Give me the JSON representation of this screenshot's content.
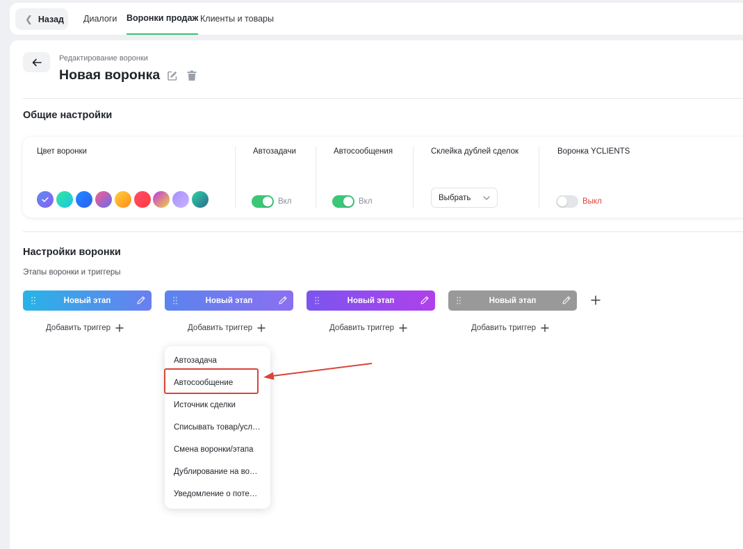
{
  "topnav": {
    "back_label": "Назад",
    "tabs": [
      {
        "label": "Диалоги",
        "active": false
      },
      {
        "label": "Воронки продаж",
        "active": true
      },
      {
        "label": "Клиенты и товары",
        "active": false
      }
    ]
  },
  "header": {
    "subtitle": "Редактирование воронки",
    "title": "Новая воронка",
    "icons": [
      "arrow-left-icon",
      "edit-icon",
      "trash-icon"
    ]
  },
  "general": {
    "title": "Общие настройки",
    "color_label": "Цвет воронки",
    "colors": [
      {
        "from": "#5a8dee",
        "to": "#8b5cf6",
        "selected": true
      },
      {
        "from": "#32e7a0",
        "to": "#19c6e6",
        "selected": false
      },
      {
        "from": "#1e8bff",
        "to": "#2f5cf5",
        "selected": false
      },
      {
        "from": "#ff5b8a",
        "to": "#5f6df2",
        "selected": false
      },
      {
        "from": "#ffd23a",
        "to": "#ff8a1c",
        "selected": false
      },
      {
        "from": "#ff4d6d",
        "to": "#ff3b3b",
        "selected": false
      },
      {
        "from": "#c036e8",
        "to": "#f0d23c",
        "selected": false
      },
      {
        "from": "#a88dff",
        "to": "#c9b5ff",
        "selected": false
      },
      {
        "from": "#2fd3a2",
        "to": "#2c6b8e",
        "selected": false
      }
    ],
    "autotasks": {
      "label": "Автозадачи",
      "state": "Вкл",
      "on": true
    },
    "automessages": {
      "label": "Автосообщения",
      "state": "Вкл",
      "on": true
    },
    "merge": {
      "label": "Склейка дублей сделок",
      "select_value": "Выбрать"
    },
    "yclients": {
      "label": "Воронка YCLIENTS",
      "state": "Выкл",
      "on": false
    },
    "toggle_on_color": "#3ac777",
    "off_text_color": "#e0443b"
  },
  "funnel": {
    "title": "Настройки воронки",
    "caption": "Этапы воронки и триггеры",
    "stages": [
      {
        "name": "Новый этап",
        "from": "#27b4e6",
        "to": "#6a7ef0"
      },
      {
        "name": "Новый этап",
        "from": "#5b84ee",
        "to": "#8b6ff0"
      },
      {
        "name": "Новый этап",
        "from": "#7b55ee",
        "to": "#b040ec"
      },
      {
        "name": "Новый этап",
        "from": "#999999",
        "to": "#999999"
      }
    ],
    "add_trigger_label": "Добавить триггер"
  },
  "trigger_menu": {
    "items": [
      "Автозадача",
      "Автосообщение",
      "Источник сделки",
      "Списывать товар/усл…",
      "Смена воронки/этапа",
      "Дублирование на во…",
      "Уведомление о поте…"
    ],
    "highlighted_index": 1,
    "annotation_color": "#d94437"
  }
}
